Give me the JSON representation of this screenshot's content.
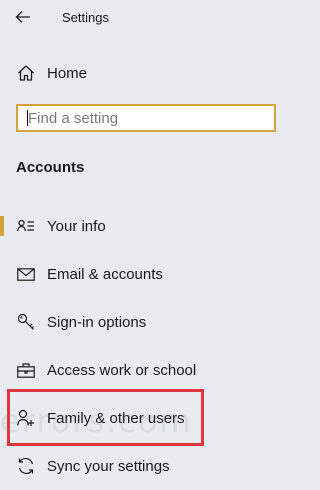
{
  "window": {
    "title": "Settings"
  },
  "home": {
    "label": "Home"
  },
  "search": {
    "placeholder": "Find a setting",
    "value": ""
  },
  "section": {
    "heading": "Accounts"
  },
  "nav": {
    "items": [
      {
        "label": "Your info",
        "icon": "person-card-icon",
        "selected": true
      },
      {
        "label": "Email & accounts",
        "icon": "envelope-icon",
        "selected": false
      },
      {
        "label": "Sign-in options",
        "icon": "key-icon",
        "selected": false
      },
      {
        "label": "Access work or school",
        "icon": "briefcase-icon",
        "selected": false
      },
      {
        "label": "Family & other users",
        "icon": "person-add-icon",
        "selected": false,
        "highlighted": true
      },
      {
        "label": "Sync your settings",
        "icon": "sync-icon",
        "selected": false
      }
    ]
  },
  "watermark": {
    "text": "errors.com"
  },
  "colors": {
    "accent": "#d6a23a",
    "highlight": "#e0363d",
    "background": "#e8ebf0"
  }
}
